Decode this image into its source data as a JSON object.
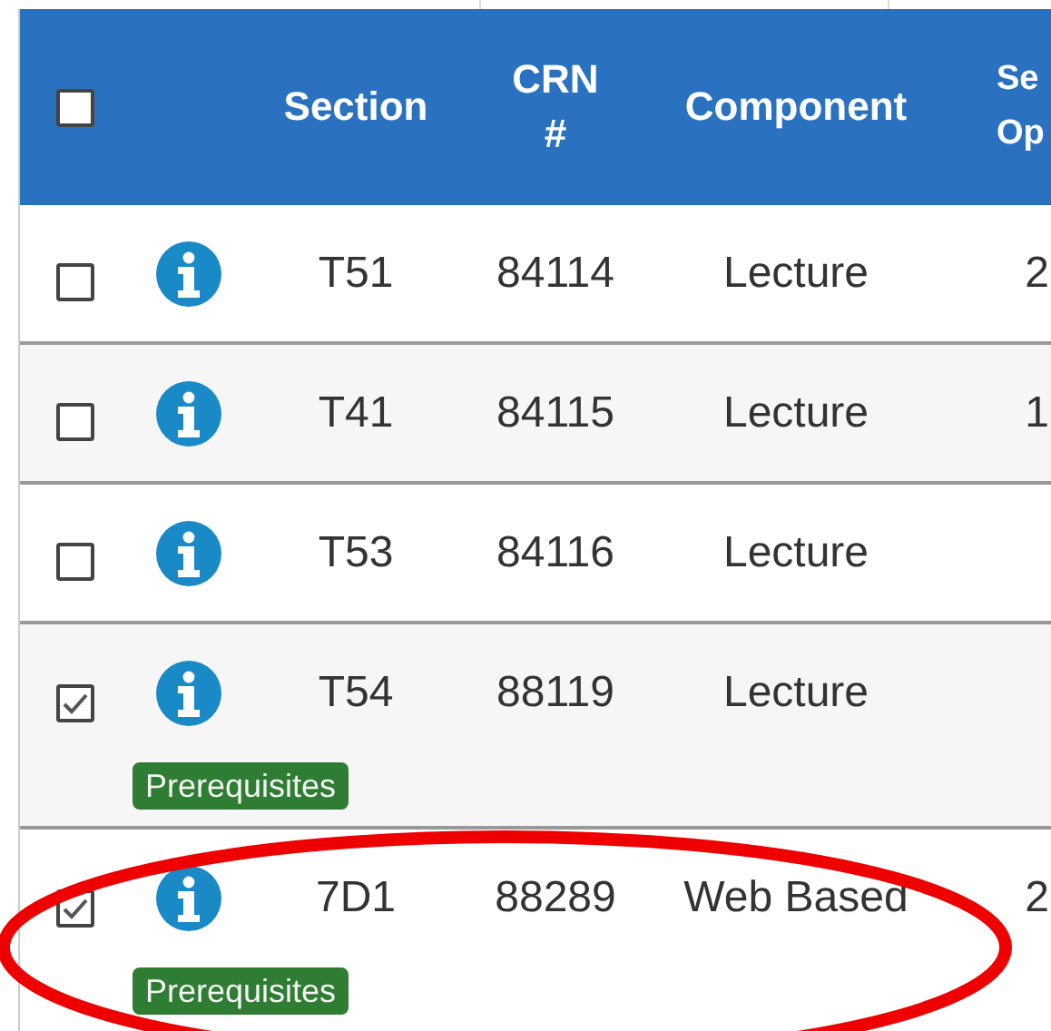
{
  "table": {
    "select_all": {
      "checked": false
    },
    "columns": [
      "Section",
      "CRN #",
      "Component",
      "Se Op"
    ],
    "rows": [
      {
        "checked": false,
        "section": "T51",
        "crn": "84114",
        "component": "Lecture",
        "column_4": "2"
      },
      {
        "checked": false,
        "section": "T41",
        "crn": "84115",
        "component": "Lecture",
        "column_4": "1"
      },
      {
        "checked": false,
        "section": "T53",
        "crn": "84116",
        "component": "Lecture"
      },
      {
        "checked": true,
        "section": "T54",
        "crn": "88119",
        "component": "Lecture",
        "badge": "Prerequisites"
      },
      {
        "checked": true,
        "section": "7D1",
        "crn": "88289",
        "component": "Web Based",
        "column_4": "2",
        "badge": "Prerequisites"
      }
    ]
  }
}
